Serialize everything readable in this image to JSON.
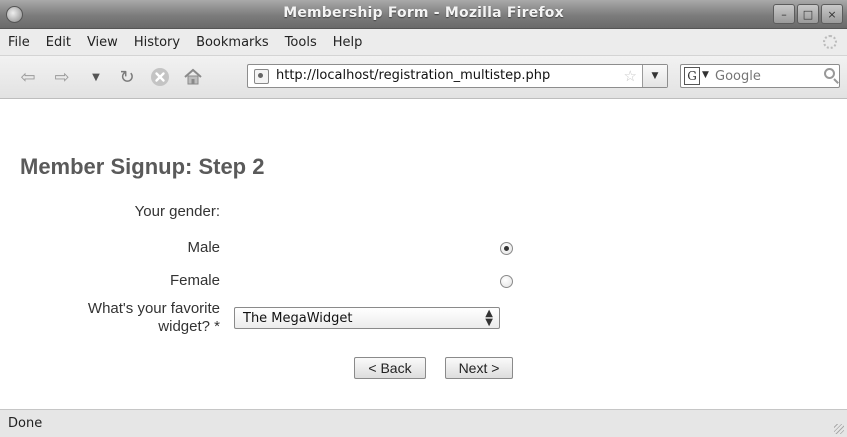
{
  "window": {
    "title": "Membership Form - Mozilla Firefox"
  },
  "menu": {
    "items": [
      {
        "label": "File"
      },
      {
        "label": "Edit"
      },
      {
        "label": "View"
      },
      {
        "label": "History"
      },
      {
        "label": "Bookmarks"
      },
      {
        "label": "Tools"
      },
      {
        "label": "Help"
      }
    ]
  },
  "toolbar": {
    "url": "http://localhost/registration_multistep.php",
    "search_placeholder": "Google",
    "search_engine_glyph": "G",
    "icons": [
      "back-icon",
      "forward-icon",
      "history-dropdown-icon",
      "reload-icon",
      "stop-icon",
      "home-icon",
      "site-identity-icon",
      "bookmark-star-icon",
      "search-icon"
    ]
  },
  "form": {
    "heading": "Member Signup: Step 2",
    "gender_label": "Your gender:",
    "gender_options": [
      {
        "label": "Male",
        "checked": true
      },
      {
        "label": "Female",
        "checked": false
      }
    ],
    "widget_label_line1": "What's your favorite",
    "widget_label_line2": "widget? *",
    "widget_selected": "The MegaWidget",
    "back_label": "< Back",
    "next_label": "Next >"
  },
  "status": {
    "text": "Done"
  }
}
